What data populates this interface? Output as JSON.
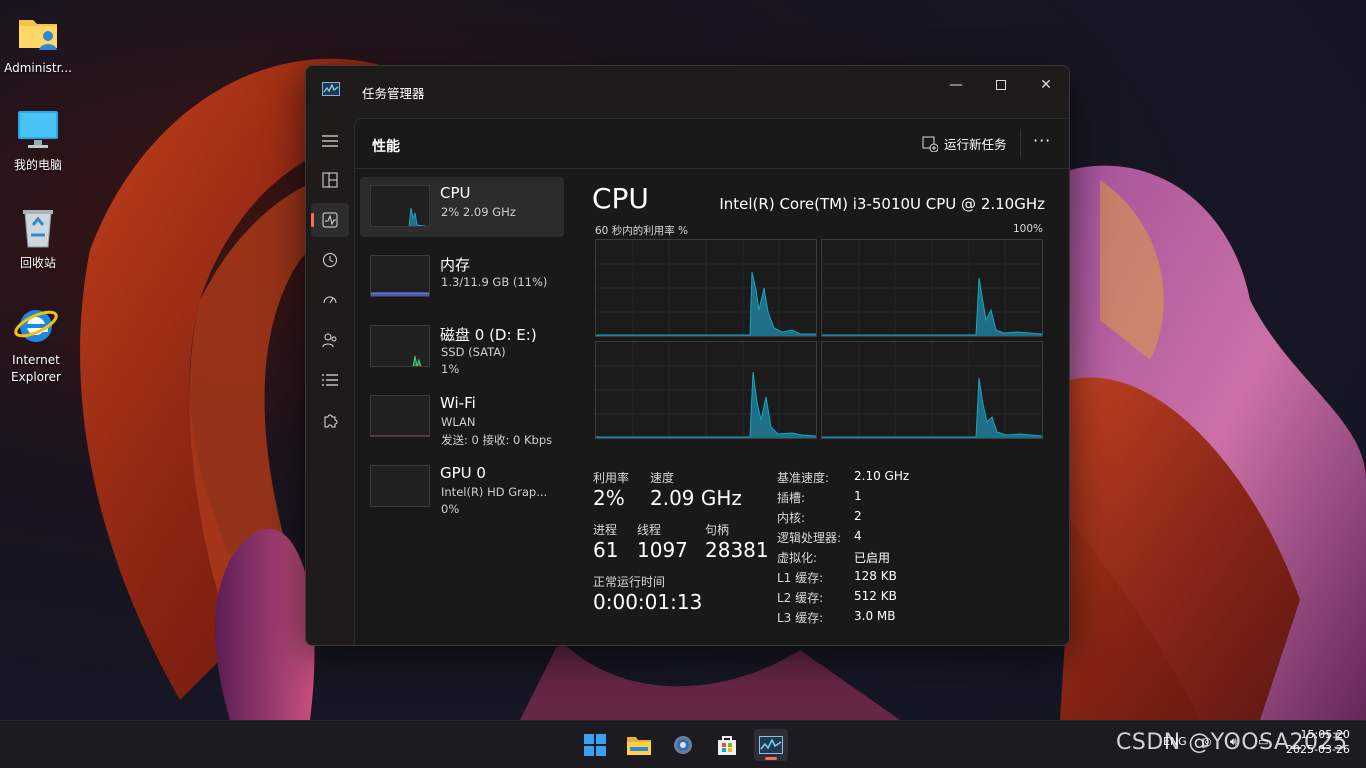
{
  "desktop": {
    "icons": [
      {
        "label": "Administr..."
      },
      {
        "label": "我的电脑"
      },
      {
        "label": "回收站"
      },
      {
        "label": "Internet Explorer"
      }
    ]
  },
  "window": {
    "title": "任务管理器",
    "section_title": "性能",
    "run_new_task": "运行新任务",
    "more": "···"
  },
  "resources": [
    {
      "name": "CPU",
      "line1": "2% 2.09 GHz",
      "line2": ""
    },
    {
      "name": "内存",
      "line1": "1.3/11.9 GB (11%)",
      "line2": ""
    },
    {
      "name": "磁盘 0 (D: E:)",
      "line1": "SSD (SATA)",
      "line2": "1%"
    },
    {
      "name": "Wi-Fi",
      "line1": "WLAN",
      "line2": "发送: 0 接收: 0 Kbps"
    },
    {
      "name": "GPU 0",
      "line1": "Intel(R) HD Grap...",
      "line2": "0%"
    }
  ],
  "cpu": {
    "title": "CPU",
    "model": "Intel(R) Core(TM) i3-5010U CPU @ 2.10GHz",
    "util_label": "60 秒内的利用率 %",
    "util_max": "100%",
    "stats": {
      "util_label": "利用率",
      "util_value": "2%",
      "speed_label": "速度",
      "speed_value": "2.09 GHz",
      "proc_label": "进程",
      "proc_value": "61",
      "thread_label": "线程",
      "thread_value": "1097",
      "handle_label": "句柄",
      "handle_value": "28381",
      "uptime_label": "正常运行时间",
      "uptime_value": "0:00:01:13"
    },
    "specs": [
      {
        "k": "基准速度:",
        "v": "2.10 GHz"
      },
      {
        "k": "插槽:",
        "v": "1"
      },
      {
        "k": "内核:",
        "v": "2"
      },
      {
        "k": "逻辑处理器:",
        "v": "4"
      },
      {
        "k": "虚拟化:",
        "v": "已启用"
      },
      {
        "k": "L1 缓存:",
        "v": "128 KB"
      },
      {
        "k": "L2 缓存:",
        "v": "512 KB"
      },
      {
        "k": "L3 缓存:",
        "v": "3.0 MB"
      }
    ]
  },
  "taskbar": {
    "lang": "ENG",
    "time": "15:05:20",
    "date": "2025-03-26"
  },
  "watermark": "CSDN @YOOSA2025",
  "colors": {
    "accent": "#ff6a5a",
    "graph_line": "#17a3c4",
    "graph_fill": "#1f6f86"
  }
}
